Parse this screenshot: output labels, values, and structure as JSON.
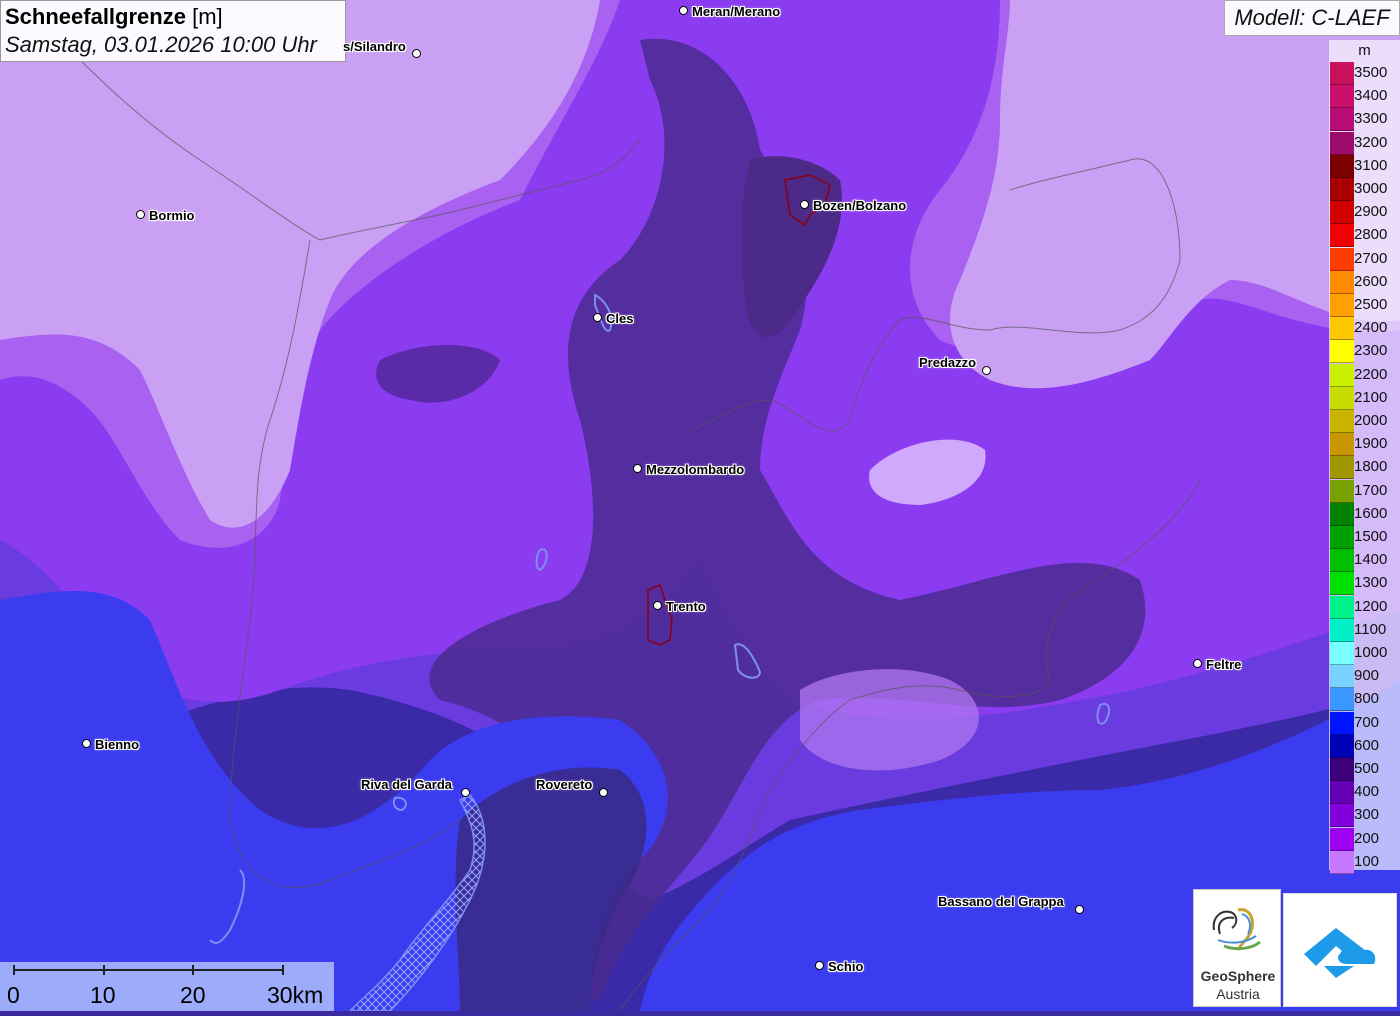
{
  "header": {
    "title_main": "Schneefallgrenze",
    "title_unit": "[m]",
    "datetime": "Samstag, 03.01.2026 10:00 Uhr"
  },
  "model": {
    "label": "Modell: C-LAEF"
  },
  "legend": {
    "unit": "m",
    "entries": [
      {
        "label": "3500",
        "color": "#c8115a"
      },
      {
        "label": "3400",
        "color": "#c8106a"
      },
      {
        "label": "3300",
        "color": "#b80c74"
      },
      {
        "label": "3200",
        "color": "#9e0a6a"
      },
      {
        "label": "3100",
        "color": "#7d0000"
      },
      {
        "label": "3000",
        "color": "#a80000"
      },
      {
        "label": "2900",
        "color": "#d10000"
      },
      {
        "label": "2800",
        "color": "#f00000"
      },
      {
        "label": "2700",
        "color": "#ff3c00"
      },
      {
        "label": "2600",
        "color": "#ff8c00"
      },
      {
        "label": "2500",
        "color": "#ffa000"
      },
      {
        "label": "2400",
        "color": "#ffc800"
      },
      {
        "label": "2300",
        "color": "#ffff00"
      },
      {
        "label": "2200",
        "color": "#c8f000"
      },
      {
        "label": "2100",
        "color": "#c8dc00"
      },
      {
        "label": "2000",
        "color": "#c8b400"
      },
      {
        "label": "1900",
        "color": "#c89600"
      },
      {
        "label": "1800",
        "color": "#a09600"
      },
      {
        "label": "1700",
        "color": "#78a000"
      },
      {
        "label": "1600",
        "color": "#008200"
      },
      {
        "label": "1500",
        "color": "#00a000"
      },
      {
        "label": "1400",
        "color": "#00be00"
      },
      {
        "label": "1300",
        "color": "#00e000"
      },
      {
        "label": "1200",
        "color": "#00f08c"
      },
      {
        "label": "1100",
        "color": "#00f0c8"
      },
      {
        "label": "1000",
        "color": "#78ffff"
      },
      {
        "label": "900",
        "color": "#78d2ff"
      },
      {
        "label": "800",
        "color": "#3c96ff"
      },
      {
        "label": "700",
        "color": "#0014ff"
      },
      {
        "label": "600",
        "color": "#0000b4"
      },
      {
        "label": "500",
        "color": "#3c0078"
      },
      {
        "label": "400",
        "color": "#6400b4"
      },
      {
        "label": "300",
        "color": "#8200dc"
      },
      {
        "label": "200",
        "color": "#a000f0"
      },
      {
        "label": "100",
        "color": "#c878ff"
      }
    ]
  },
  "cities": [
    {
      "name": "Meran/Merano"
    },
    {
      "name": "s/Silandro"
    },
    {
      "name": "Bormio"
    },
    {
      "name": "Bozen/Bolzano"
    },
    {
      "name": "Cles"
    },
    {
      "name": "Predazzo"
    },
    {
      "name": "Mezzolombardo"
    },
    {
      "name": "Trento"
    },
    {
      "name": "Feltre"
    },
    {
      "name": "Bienno"
    },
    {
      "name": "Riva del Garda"
    },
    {
      "name": "Rovereto"
    },
    {
      "name": "Bassano del Grappa"
    },
    {
      "name": "Schio"
    }
  ],
  "scale": {
    "labels": [
      "0",
      "10",
      "20",
      "30km"
    ]
  },
  "logos": {
    "geosphere_line1": "GeoSphere",
    "geosphere_line2": "Austria"
  }
}
